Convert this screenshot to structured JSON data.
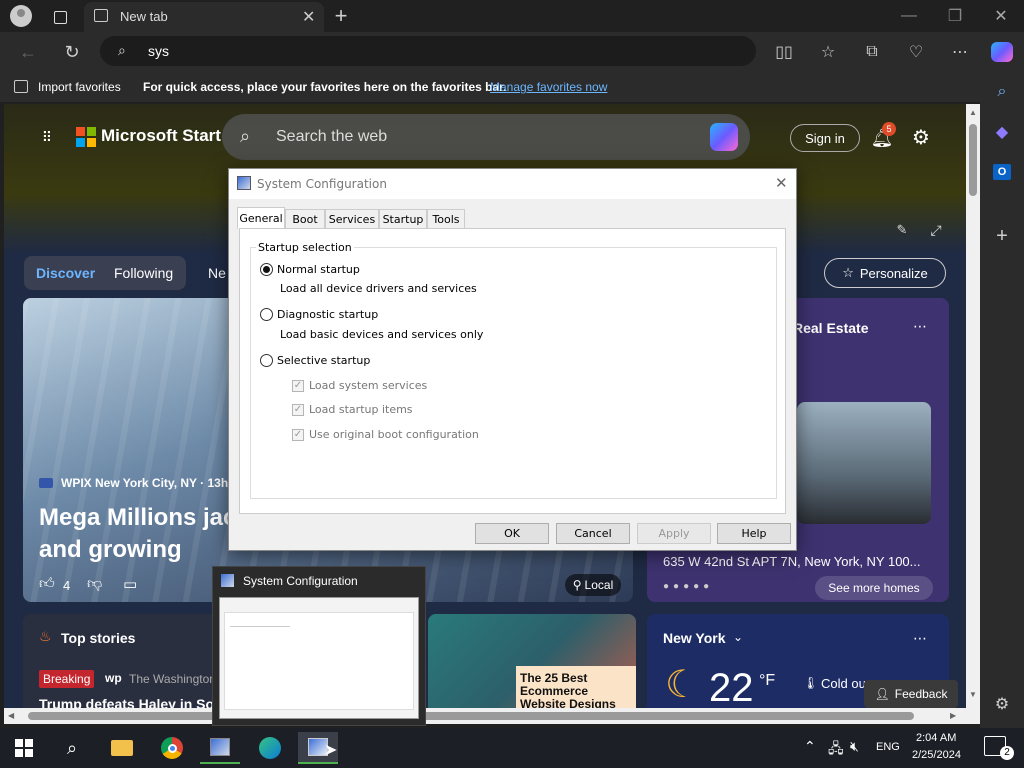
{
  "browser": {
    "tab_title": "New tab",
    "address_value": "sys",
    "favbar": {
      "import_label": "Import favorites",
      "hint": "For quick access, place your favorites here on the favorites bar.",
      "manage_link": "Manage favorites now"
    }
  },
  "msn": {
    "brand": "Microsoft Start",
    "search_placeholder": "Search the web",
    "signin": "Sign in",
    "notif_count": "5",
    "tabs": [
      "Discover",
      "Following",
      "Ne"
    ],
    "personalize": "Personalize",
    "main_card": {
      "source": "WPIX New York City, NY · 13h",
      "headline": "Mega Millions jac\nand growing",
      "likes": "4",
      "local": "Local"
    },
    "real_estate": {
      "title": "Real Estate",
      "address": "635 W 42nd St APT 7N, New York, NY 100...",
      "button": "See more homes"
    },
    "top_stories": {
      "title": "Top stories",
      "badge": "Breaking",
      "source": "The Washington",
      "headline": "Trump defeats Haley in Sou"
    },
    "ecom": "The 25 Best Ecommerce Website Designs",
    "weather": {
      "city": "New York",
      "temp": "22",
      "unit": "°F",
      "desc": "Cold ou"
    },
    "feedback": "Feedback"
  },
  "dialog": {
    "title": "System Configuration",
    "tabs": [
      "General",
      "Boot",
      "Services",
      "Startup",
      "Tools"
    ],
    "group_label": "Startup selection",
    "normal": "Normal startup",
    "normal_desc": "Load all device drivers and services",
    "diagnostic": "Diagnostic startup",
    "diagnostic_desc": "Load basic devices and services only",
    "selective": "Selective startup",
    "chk1": "Load system services",
    "chk2": "Load startup items",
    "chk3": "Use original boot configuration",
    "buttons": {
      "ok": "OK",
      "cancel": "Cancel",
      "apply": "Apply",
      "help": "Help"
    }
  },
  "thumbnail_title": "System Configuration",
  "taskbar": {
    "lang": "ENG",
    "time": "2:04 AM",
    "date": "2/25/2024",
    "notif": "2"
  }
}
